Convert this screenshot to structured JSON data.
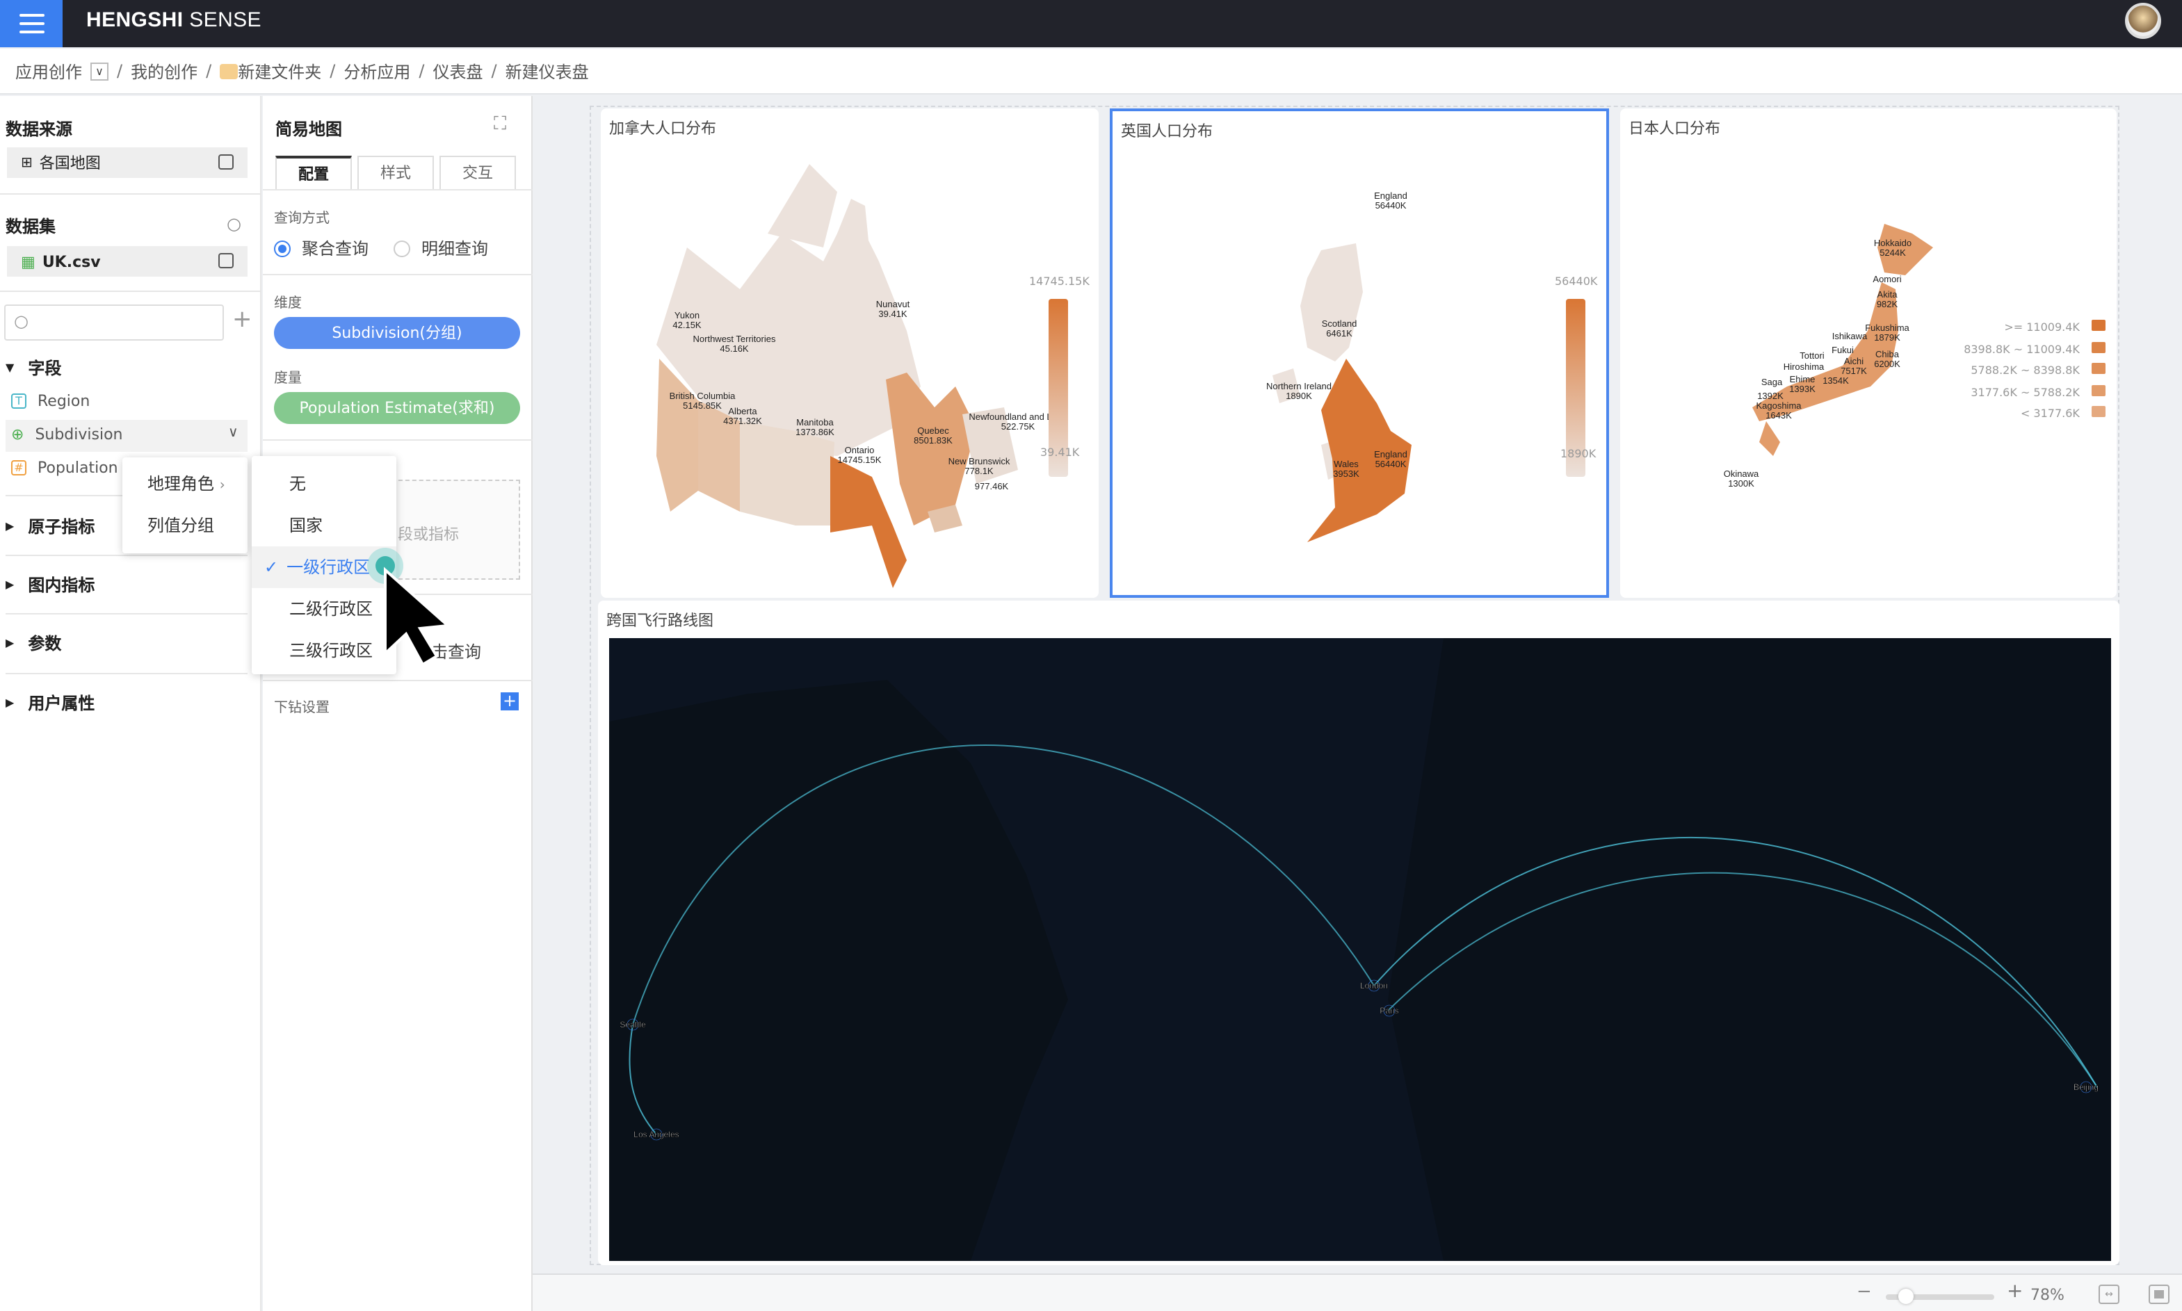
{
  "header": {
    "brand_bold": "HENGSHI",
    "brand_light": "SENSE"
  },
  "breadcrumb": {
    "items": [
      "应用创作",
      "我的创作",
      "新建文件夹",
      "分析应用",
      "仪表盘",
      "新建仪表盘"
    ]
  },
  "left": {
    "datasource_title": "数据来源",
    "datasource": "各国地图",
    "dataset_title": "数据集",
    "dataset": "UK.csv",
    "search_placeholder": "",
    "fields_title": "字段",
    "fields": [
      "Region",
      "Subdivision",
      "Population E"
    ],
    "sections": [
      "原子指标",
      "图内指标",
      "参数",
      "用户属性"
    ]
  },
  "context_menu": {
    "items": [
      "地理角色",
      "列值分组"
    ]
  },
  "geo_submenu": {
    "items": [
      "无",
      "国家",
      "一级行政区",
      "二级行政区",
      "三级行政区"
    ],
    "selected": "一级行政区"
  },
  "config": {
    "title": "简易地图",
    "tabs": [
      "配置",
      "样式",
      "交互"
    ],
    "query_label": "查询方式",
    "query_options": [
      "聚合查询",
      "明细查询"
    ],
    "query_selected": "聚合查询",
    "dimension_label": "维度",
    "dimension": "Subdivision(分组)",
    "measure_label": "度量",
    "measure": "Population Estimate(求和)",
    "drop_hint": "段或指标",
    "click_query": "击查询",
    "drill_label": "下钻设置"
  },
  "colors": {
    "accent": "#3a7ff0",
    "measure": "#85c98f",
    "map_high": "#d97634",
    "map_low": "#ece2dc"
  },
  "cards": {
    "canada": {
      "title": "加拿大人口分布",
      "legend_max": "14745.15K",
      "legend_min": "39.41K",
      "regions": [
        [
          "Yukon",
          "42.15K"
        ],
        [
          "Northwest Territories",
          "45.16K"
        ],
        [
          "Nunavut",
          "39.41K"
        ],
        [
          "British Columbia",
          "5145.85K"
        ],
        [
          "Alberta",
          "4371.32K"
        ],
        [
          "Manitoba",
          "1373.86K"
        ],
        [
          "Ontario",
          "14745.15K"
        ],
        [
          "Quebec",
          "8501.83K"
        ],
        [
          "Newfoundland and L    dor",
          "522.75K"
        ],
        [
          "New Brunswick",
          "778.1K"
        ],
        [
          "",
          "977.46K"
        ]
      ]
    },
    "uk": {
      "title": "英国人口分布",
      "legend_max": "56440K",
      "legend_min": "1890K",
      "regions": [
        [
          "England",
          "56440K"
        ],
        [
          "Scotland",
          "6461K"
        ],
        [
          "Northern Ireland",
          "1890K"
        ],
        [
          "Wales",
          "3953K"
        ],
        [
          "England",
          "56440K"
        ]
      ]
    },
    "japan": {
      "title": "日本人口分布",
      "regions": [
        [
          "Hokkaido",
          "5244K"
        ],
        [
          "Aomori",
          ""
        ],
        [
          "Akita",
          "982K"
        ],
        [
          "Fukushima",
          "1879K"
        ],
        [
          "Ishikawa",
          ""
        ],
        [
          "Fukui",
          ""
        ],
        [
          "Chiba",
          "6200K"
        ],
        [
          "Tottori",
          ""
        ],
        [
          "Hiroshima",
          ""
        ],
        [
          "Aichi",
          "7517K"
        ],
        [
          "",
          "1354K"
        ],
        [
          "Saga",
          "1392K"
        ],
        [
          "Ehime",
          "1393K"
        ],
        [
          "Kagoshima",
          "1643K"
        ],
        [
          "Okinawa",
          "1300K"
        ]
      ],
      "legend": [
        ">= 11009.4K",
        "8398.8K ~ 11009.4K",
        "5788.2K ~ 8398.8K",
        "3177.6K ~ 5788.2K",
        "< 3177.6K"
      ],
      "legend_colors": [
        "#d97634",
        "#dc8447",
        "#df8f57",
        "#e29c6a",
        "#e5a97f"
      ]
    },
    "flights": {
      "title": "跨国飞行路线图",
      "cities": [
        "Seattle",
        "Los Angeles",
        "London",
        "Paris",
        "Beijing"
      ]
    }
  },
  "footer": {
    "zoom": "78%",
    "zoom_value": 78
  }
}
